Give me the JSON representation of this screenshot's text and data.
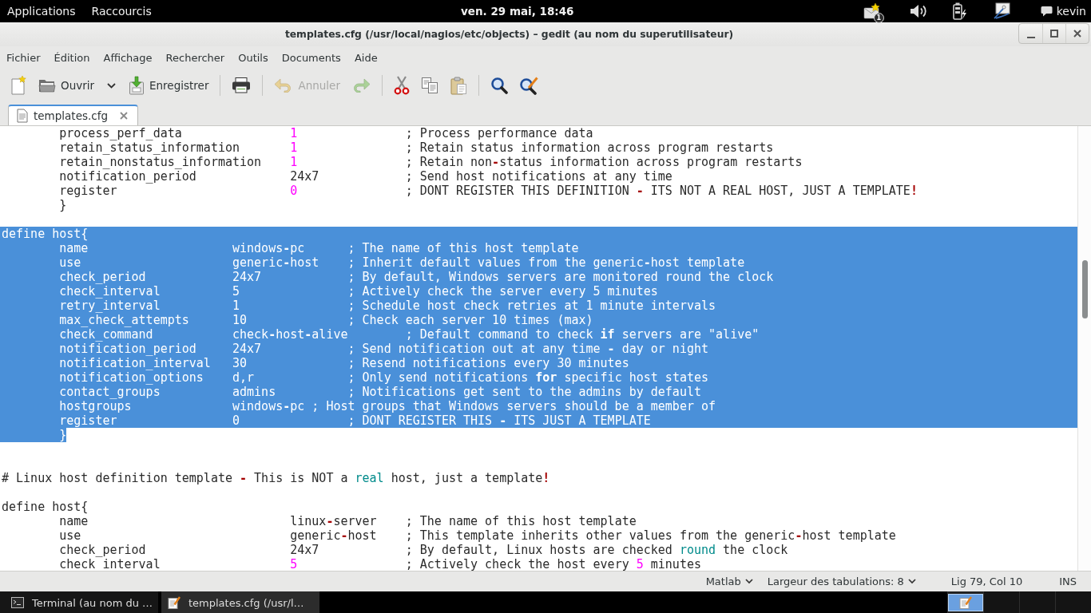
{
  "top_bar": {
    "menus": [
      "Applications",
      "Raccourcis"
    ],
    "clock": "ven. 29 mai, 18:46",
    "notification_count": "1",
    "user": "kevin"
  },
  "window": {
    "title": "templates.cfg (/usr/local/nagios/etc/objects) – gedit (au nom du superutilisateur)"
  },
  "menu_bar": [
    "Fichier",
    "Édition",
    "Affichage",
    "Rechercher",
    "Outils",
    "Documents",
    "Aide"
  ],
  "toolbar": {
    "open": {
      "label": "Ouvrir"
    },
    "save": {
      "label": "Enregistrer"
    },
    "undo": {
      "label": "Annuler",
      "disabled": true
    },
    "redo": {
      "disabled": true
    }
  },
  "tabs": [
    {
      "label": "templates.cfg",
      "selected": true
    }
  ],
  "editor": {
    "lines": [
      {
        "kind": "code",
        "selected": false,
        "segments": [
          {
            "kind": "plain",
            "text": "\tprocess_perf_data\t\t"
          },
          {
            "kind": "number",
            "text": "1"
          },
          {
            "kind": "plain",
            "text": "\t\t; Process performance data"
          }
        ]
      },
      {
        "kind": "code",
        "selected": false,
        "segments": [
          {
            "kind": "plain",
            "text": "\tretain_status_information\t"
          },
          {
            "kind": "number",
            "text": "1"
          },
          {
            "kind": "plain",
            "text": "\t\t; Retain status information across program restarts"
          }
        ]
      },
      {
        "kind": "code",
        "selected": false,
        "segments": [
          {
            "kind": "plain",
            "text": "\tretain_nonstatus_information\t"
          },
          {
            "kind": "number",
            "text": "1"
          },
          {
            "kind": "plain",
            "text": "\t\t; Retain non"
          },
          {
            "kind": "operator",
            "text": "-"
          },
          {
            "kind": "plain",
            "text": "status information across program restarts"
          }
        ]
      },
      {
        "kind": "code",
        "selected": false,
        "segments": [
          {
            "kind": "plain",
            "text": "\tnotification_period\t\t24x7\t\t; Send host notifications at any time"
          }
        ]
      },
      {
        "kind": "code",
        "selected": false,
        "segments": [
          {
            "kind": "plain",
            "text": "\tregister\t\t\t"
          },
          {
            "kind": "number",
            "text": "0"
          },
          {
            "kind": "plain",
            "text": "\t\t; DONT REGISTER THIS DEFINITION "
          },
          {
            "kind": "operator",
            "text": "-"
          },
          {
            "kind": "plain",
            "text": " ITS NOT A REAL HOST, JUST A TEMPLATE"
          },
          {
            "kind": "operator",
            "text": "!"
          }
        ]
      },
      {
        "kind": "code",
        "selected": false,
        "segments": [
          {
            "kind": "plain",
            "text": "\t}"
          }
        ]
      },
      {
        "kind": "blank"
      },
      {
        "kind": "code",
        "selected": true,
        "segments": [
          {
            "kind": "plain",
            "text": "define host{"
          }
        ]
      },
      {
        "kind": "code",
        "selected": true,
        "segments": [
          {
            "kind": "plain",
            "text": "\tname\t\t\twindows"
          },
          {
            "kind": "operator",
            "text": "-"
          },
          {
            "kind": "plain",
            "text": "pc\t; The name of this host template"
          }
        ]
      },
      {
        "kind": "code",
        "selected": true,
        "segments": [
          {
            "kind": "plain",
            "text": "\tuse\t\t\tgeneric"
          },
          {
            "kind": "operator",
            "text": "-"
          },
          {
            "kind": "plain",
            "text": "host\t; Inherit default values from the generic"
          },
          {
            "kind": "operator",
            "text": "-"
          },
          {
            "kind": "plain",
            "text": "host template"
          }
        ]
      },
      {
        "kind": "code",
        "selected": true,
        "segments": [
          {
            "kind": "plain",
            "text": "\tcheck_period\t\t24x7\t\t; By default, Windows servers are monitored round the clock"
          }
        ]
      },
      {
        "kind": "code",
        "selected": true,
        "segments": [
          {
            "kind": "plain",
            "text": "\tcheck_interval\t\t5\t\t; Actively check the server every 5 minutes"
          }
        ]
      },
      {
        "kind": "code",
        "selected": true,
        "segments": [
          {
            "kind": "plain",
            "text": "\tretry_interval\t\t1\t\t; Schedule host check retries at 1 minute intervals"
          }
        ]
      },
      {
        "kind": "code",
        "selected": true,
        "segments": [
          {
            "kind": "plain",
            "text": "\tmax_check_attempts\t10\t\t; Check each server 10 times (max)"
          }
        ]
      },
      {
        "kind": "code",
        "selected": true,
        "segments": [
          {
            "kind": "plain",
            "text": "\tcheck_command\t\tcheck"
          },
          {
            "kind": "operator",
            "text": "-"
          },
          {
            "kind": "plain",
            "text": "host"
          },
          {
            "kind": "operator",
            "text": "-"
          },
          {
            "kind": "plain",
            "text": "alive\t; Default command to check "
          },
          {
            "kind": "keyword",
            "text": "if"
          },
          {
            "kind": "plain",
            "text": " servers are \"alive\""
          }
        ]
      },
      {
        "kind": "code",
        "selected": true,
        "segments": [
          {
            "kind": "plain",
            "text": "\tnotification_period\t24x7\t\t; Send notification out at any time "
          },
          {
            "kind": "operator",
            "text": "-"
          },
          {
            "kind": "plain",
            "text": " day or night"
          }
        ]
      },
      {
        "kind": "code",
        "selected": true,
        "segments": [
          {
            "kind": "plain",
            "text": "\tnotification_interval\t30\t\t; Resend notifications every 30 minutes"
          }
        ]
      },
      {
        "kind": "code",
        "selected": true,
        "segments": [
          {
            "kind": "plain",
            "text": "\tnotification_options\td,r\t\t; Only send notifications "
          },
          {
            "kind": "keyword",
            "text": "for"
          },
          {
            "kind": "plain",
            "text": " specific host states"
          }
        ]
      },
      {
        "kind": "code",
        "selected": true,
        "segments": [
          {
            "kind": "plain",
            "text": "\tcontact_groups\t\tadmins\t\t; Notifications get sent to the admins by default"
          }
        ]
      },
      {
        "kind": "code",
        "selected": true,
        "segments": [
          {
            "kind": "plain",
            "text": "\thostgroups\t\twindows"
          },
          {
            "kind": "operator",
            "text": "-"
          },
          {
            "kind": "plain",
            "text": "pc ; Host groups that Windows servers should be a member of"
          }
        ]
      },
      {
        "kind": "code",
        "selected": true,
        "segments": [
          {
            "kind": "plain",
            "text": "\tregister\t\t0\t\t; DONT REGISTER THIS "
          },
          {
            "kind": "operator",
            "text": "-"
          },
          {
            "kind": "plain",
            "text": " ITS JUST A TEMPLATE"
          }
        ]
      },
      {
        "kind": "code",
        "selected": true,
        "segments": [
          {
            "kind": "plain",
            "text": "\t}"
          }
        ]
      },
      {
        "kind": "blank"
      },
      {
        "kind": "blank"
      },
      {
        "kind": "code",
        "selected": false,
        "segments": [
          {
            "kind": "plain",
            "text": "# Linux host definition template "
          },
          {
            "kind": "operator",
            "text": "-"
          },
          {
            "kind": "plain",
            "text": " This is NOT a "
          },
          {
            "kind": "function",
            "text": "real"
          },
          {
            "kind": "plain",
            "text": " host, just a template"
          },
          {
            "kind": "operator",
            "text": "!"
          }
        ]
      },
      {
        "kind": "blank"
      },
      {
        "kind": "code",
        "selected": false,
        "segments": [
          {
            "kind": "plain",
            "text": "define host{"
          }
        ]
      },
      {
        "kind": "code",
        "selected": false,
        "segments": [
          {
            "kind": "plain",
            "text": "\tname\t\t\t\tlinux"
          },
          {
            "kind": "operator",
            "text": "-"
          },
          {
            "kind": "plain",
            "text": "server\t; The name of this host template"
          }
        ]
      },
      {
        "kind": "code",
        "selected": false,
        "segments": [
          {
            "kind": "plain",
            "text": "\tuse\t\t\t\tgeneric"
          },
          {
            "kind": "operator",
            "text": "-"
          },
          {
            "kind": "plain",
            "text": "host\t; This template inherits other values from the generic"
          },
          {
            "kind": "operator",
            "text": "-"
          },
          {
            "kind": "plain",
            "text": "host template"
          }
        ]
      },
      {
        "kind": "code",
        "selected": false,
        "segments": [
          {
            "kind": "plain",
            "text": "\tcheck_period\t\t\t24x7\t\t; By default, Linux hosts are checked "
          },
          {
            "kind": "function",
            "text": "round"
          },
          {
            "kind": "plain",
            "text": " the clock"
          }
        ]
      },
      {
        "kind": "code",
        "selected": false,
        "segments": [
          {
            "kind": "plain",
            "text": "\tcheck_interval\t\t\t"
          },
          {
            "kind": "number",
            "text": "5"
          },
          {
            "kind": "plain",
            "text": "\t\t; Actively check the host every "
          },
          {
            "kind": "number",
            "text": "5"
          },
          {
            "kind": "plain",
            "text": " minutes"
          }
        ]
      }
    ]
  },
  "status_bar": {
    "language": "Matlab",
    "tab_width": "Largeur des tabulations: 8",
    "position": "Lig 79, Col 10",
    "mode": "INS"
  },
  "taskbar": {
    "windows": [
      {
        "kind": "terminal",
        "label": "Terminal (au nom du …",
        "selected": false
      },
      {
        "kind": "editor",
        "label": "templates.cfg (/usr/l…",
        "selected": true
      }
    ],
    "workspaces": [
      {
        "selected": true
      },
      {
        "selected": false
      },
      {
        "selected": false
      },
      {
        "selected": false
      }
    ]
  }
}
